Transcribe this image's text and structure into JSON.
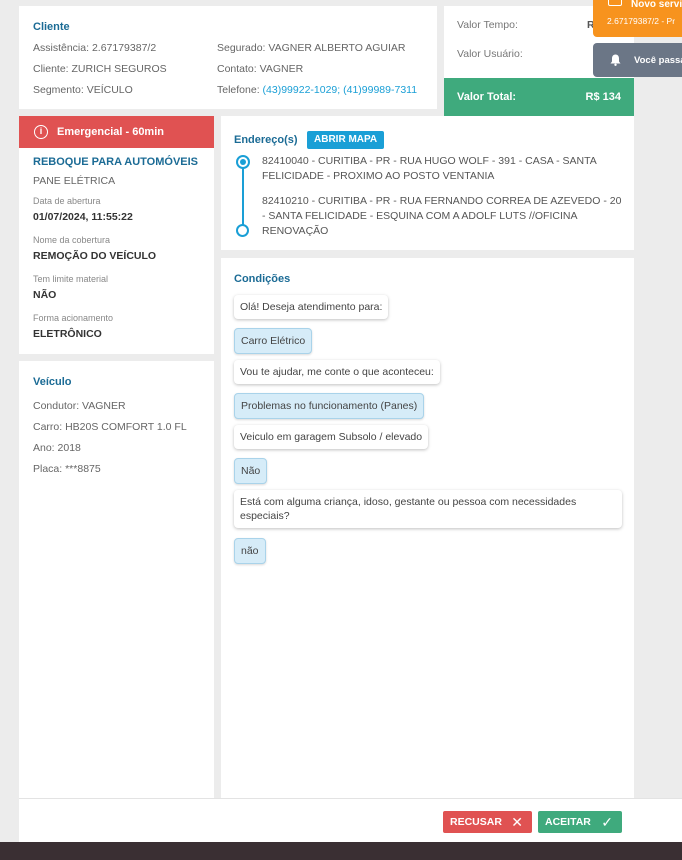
{
  "client": {
    "title": "Cliente",
    "assistencia": "Assistência: 2.67179387/2",
    "cliente": "Cliente: ZURICH SEGUROS",
    "segmento": "Segmento: VEÍCULO",
    "segurado": "Segurado: VAGNER ALBERTO AGUIAR",
    "contato": "Contato: VAGNER",
    "telefone_label": "Telefone:",
    "telefone_value": "(43)99922-1029; (41)99989-7311"
  },
  "values": {
    "tempo_label": "Valor Tempo:",
    "tempo_value": "R",
    "usuario_label": "Valor Usuário:",
    "total_label": "Valor Total:",
    "total_value": "R$ 134"
  },
  "notifications": {
    "n1_title": "Novo servi",
    "n1_sub": "2.67179387/2 - Pr",
    "n2_title": "Você passa"
  },
  "emergency": {
    "header": "Emergencial - 60min",
    "service": "REBOQUE PARA AUTOMÓVEIS",
    "problem": "PANE ELÉTRICA",
    "opening_label": "Data de abertura",
    "opening_value": "01/07/2024, 11:55:22",
    "coverage_label": "Nome da cobertura",
    "coverage_value": "REMOÇÃO DO VEÍCULO",
    "limit_label": "Tem limite material",
    "limit_value": "NÃO",
    "trigger_label": "Forma acionamento",
    "trigger_value": "ELETRÔNICO"
  },
  "vehicle": {
    "title": "Veículo",
    "condutor": "Condutor: VAGNER",
    "carro": "Carro: HB20S COMFORT 1.0 FL",
    "ano": "Ano: 2018",
    "placa": "Placa: ***8875"
  },
  "address": {
    "title": "Endereço(s)",
    "map_button": "ABRIR MAPA",
    "origin": "82410040 - CURITIBA - PR - RUA HUGO WOLF - 391 - CASA - SANTA FELICIDADE - PROXIMO AO POSTO VENTANIA",
    "destination": "82410210 - CURITIBA - PR - RUA FERNANDO CORREA DE AZEVEDO - 20 - SANTA FELICIDADE - ESQUINA COM A ADOLF LUTS //OFICINA RENOVAÇÃO"
  },
  "conditions": {
    "title": "Condições",
    "messages": [
      {
        "text": "Olá! Deseja atendimento para:",
        "type": "question"
      },
      {
        "text": "Carro Elétrico",
        "type": "answer"
      },
      {
        "text": "Vou te ajudar, me conte o que aconteceu:",
        "type": "question"
      },
      {
        "text": "Problemas no funcionamento (Panes)",
        "type": "answer"
      },
      {
        "text": "Veiculo em garagem Subsolo / elevado",
        "type": "question"
      },
      {
        "text": "Não",
        "type": "answer"
      },
      {
        "text": "Está com alguma criança, idoso, gestante ou pessoa com necessidades especiais?",
        "type": "question"
      },
      {
        "text": "não",
        "type": "answer"
      }
    ]
  },
  "footer": {
    "refuse_label": "RECUSAR",
    "accept_label": "ACEITAR"
  },
  "colors": {
    "accent_blue": "#1a9fd6",
    "title_blue": "#1b6b95",
    "danger": "#e05252",
    "success": "#3faa7d",
    "warning": "#f7931e"
  }
}
